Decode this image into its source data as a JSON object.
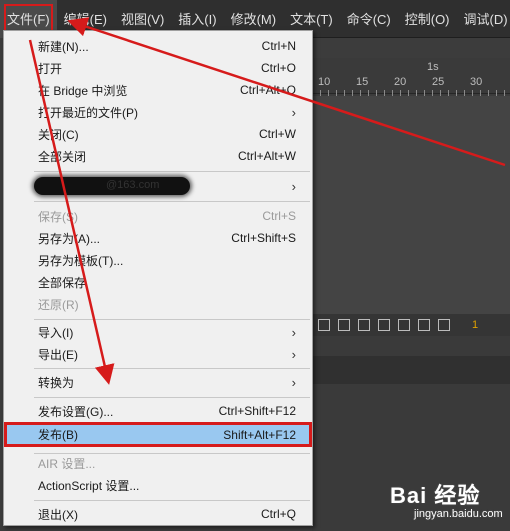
{
  "menubar": {
    "items": [
      "文件(F)",
      "编辑(E)",
      "视图(V)",
      "插入(I)",
      "修改(M)",
      "文本(T)",
      "命令(C)",
      "控制(O)",
      "调试(D)"
    ]
  },
  "timeline": {
    "second_label": "1s",
    "ruler_numbers": [
      "10",
      "15",
      "20",
      "25",
      "30"
    ],
    "frame_number": "1"
  },
  "file_menu": {
    "items": [
      {
        "label": "新建(N)...",
        "shortcut": "Ctrl+N"
      },
      {
        "label": "打开",
        "shortcut": "Ctrl+O"
      },
      {
        "label": "在 Bridge 中浏览",
        "shortcut": "Ctrl+Alt+O"
      },
      {
        "label": "打开最近的文件(P)",
        "shortcut": "",
        "submenu": true
      },
      {
        "label": "关闭(C)",
        "shortcut": "Ctrl+W"
      },
      {
        "label": "全部关闭",
        "shortcut": "Ctrl+Alt+W"
      },
      {
        "label": "@163.com",
        "shortcut": "",
        "submenu": true
      },
      {
        "label": "保存(S)",
        "shortcut": "Ctrl+S",
        "disabled": true
      },
      {
        "label": "另存为(A)...",
        "shortcut": "Ctrl+Shift+S"
      },
      {
        "label": "另存为模板(T)...",
        "shortcut": ""
      },
      {
        "label": "全部保存",
        "shortcut": ""
      },
      {
        "label": "还原(R)",
        "shortcut": "",
        "disabled": true
      },
      {
        "label": "导入(I)",
        "shortcut": "",
        "submenu": true
      },
      {
        "label": "导出(E)",
        "shortcut": "",
        "submenu": true
      },
      {
        "label": "转换为",
        "shortcut": "",
        "submenu": true
      },
      {
        "label": "发布设置(G)...",
        "shortcut": "Ctrl+Shift+F12"
      },
      {
        "label": "发布(B)",
        "shortcut": "Shift+Alt+F12",
        "highlighted": true
      },
      {
        "label": "AIR 设置...",
        "shortcut": "",
        "disabled": true
      },
      {
        "label": "ActionScript 设置...",
        "shortcut": ""
      },
      {
        "label": "退出(X)",
        "shortcut": "Ctrl+Q"
      }
    ],
    "submenu_arrow": "›"
  },
  "watermark": {
    "brand": "Bai 经验",
    "site": "jingyan.baidu.com"
  },
  "colors": {
    "highlight": "#99c8f0",
    "annotation": "#d61b1b",
    "menubar": "#2f2f2f"
  }
}
